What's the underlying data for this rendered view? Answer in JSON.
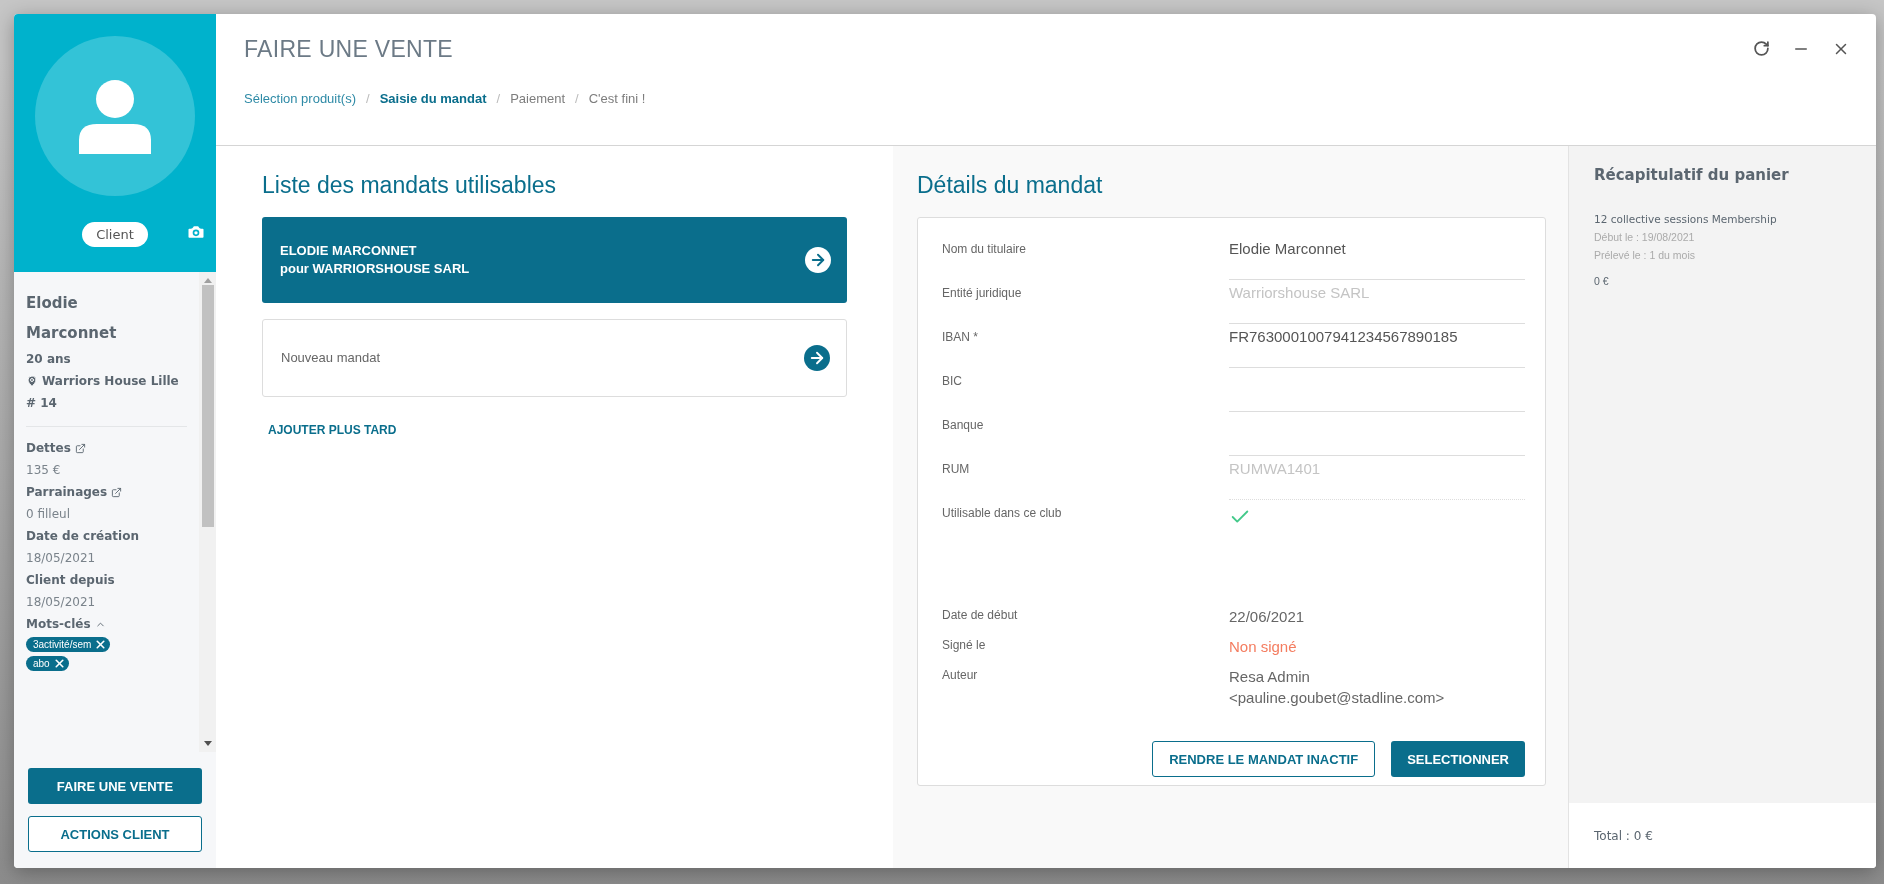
{
  "window": {
    "title": "FAIRE UNE VENTE"
  },
  "breadcrumb_separator": "/",
  "breadcrumb": [
    {
      "label": "Sélection produit(s)",
      "kind": "done"
    },
    {
      "label": "Saisie du mandat",
      "kind": "current"
    },
    {
      "label": "Paiement",
      "kind": "todo"
    },
    {
      "label": "C'est fini !",
      "kind": "todo"
    }
  ],
  "client": {
    "badge": "Client",
    "name": "Elodie Marconnet",
    "age": "20 ans",
    "club": "Warriors House Lille",
    "number": "# 14",
    "fields": [
      {
        "label": "Dettes",
        "link": true,
        "value": "135 €"
      },
      {
        "label": "Parrainages",
        "link": true,
        "value": "0 filleul"
      },
      {
        "label": "Date de création",
        "link": false,
        "value": "18/05/2021"
      },
      {
        "label": "Client depuis",
        "link": false,
        "value": "18/05/2021"
      }
    ],
    "keywords": {
      "label": "Mots-clés",
      "expanded": true,
      "tags": [
        "3activité/sem",
        "abo"
      ]
    },
    "actions": [
      {
        "label": "FAIRE UNE VENTE",
        "kind": "primary"
      },
      {
        "label": "ACTIONS CLIENT",
        "kind": "outline"
      }
    ]
  },
  "mandates": {
    "title": "Liste des mandats utilisables",
    "items": [
      {
        "title": "ELODIE MARCONNET",
        "subtitle": "pour WARRIORSHOUSE SARL",
        "selected": true
      },
      {
        "title": "Nouveau mandat",
        "selected": false
      }
    ],
    "later": "AJOUTER PLUS TARD"
  },
  "details": {
    "title": "Détails du mandat",
    "fields": [
      {
        "kind": "input",
        "label": "Nom du titulaire",
        "value": "Elodie Marconnet",
        "disabled": false
      },
      {
        "kind": "input",
        "label": "Entité juridique",
        "value": "Warriorshouse SARL",
        "disabled": true
      },
      {
        "kind": "input",
        "label": "IBAN *",
        "value": "FR7630001007941234567890185",
        "disabled": false
      },
      {
        "kind": "input",
        "label": "BIC"
      },
      {
        "kind": "input",
        "label": "Banque"
      },
      {
        "kind": "input",
        "label": "RUM",
        "value": "RUMWA1401",
        "disabled": true
      },
      {
        "kind": "check",
        "label": "Utilisable dans ce club",
        "checked": true
      }
    ],
    "info": [
      {
        "label": "Date de début",
        "value": "22/06/2021",
        "warning": false
      },
      {
        "label": "Signé le",
        "value": "Non signé",
        "warning": true
      },
      {
        "label": "Auteur",
        "value": "Resa Admin <pauline.goubet@stadline.com>",
        "warning": false
      }
    ],
    "buttons": [
      {
        "label": "RENDRE LE MANDAT INACTIF",
        "kind": "outline"
      },
      {
        "label": "SELECTIONNER",
        "kind": "primary"
      }
    ]
  },
  "cart": {
    "title": "Récapitulatif du panier",
    "items": [
      {
        "name": "12 collective sessions Membership",
        "lines": [
          "Début le : 19/08/2021",
          "Prélevé le : 1 du mois"
        ],
        "price": "0 €"
      }
    ],
    "total": "Total : 0 €"
  }
}
